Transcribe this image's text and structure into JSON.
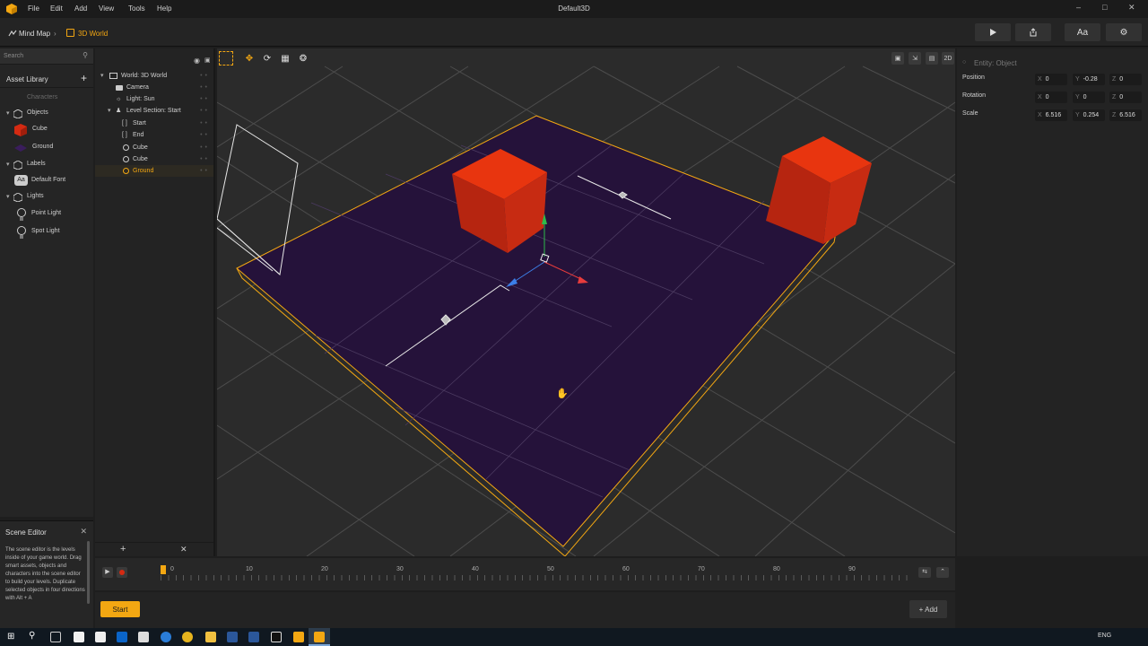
{
  "window": {
    "title": "Default3D"
  },
  "menu": [
    "File",
    "Edit",
    "Add",
    "View",
    "Tools",
    "Help"
  ],
  "breadcrumb": {
    "parent": "Mind Map",
    "current": "3D World"
  },
  "toolbar": {
    "play_icon": "play-icon",
    "share_icon": "share-icon",
    "font_label": "Aa",
    "settings_icon": "gear-icon"
  },
  "asset_library": {
    "search_placeholder": "Search",
    "title": "Asset Library",
    "items": [
      {
        "label": "Characters",
        "type": "category-dim"
      },
      {
        "label": "Objects",
        "type": "category"
      },
      {
        "label": "Cube",
        "type": "item"
      },
      {
        "label": "Ground",
        "type": "item"
      },
      {
        "label": "Labels",
        "type": "category"
      },
      {
        "label": "Default Font",
        "type": "item"
      },
      {
        "label": "Lights",
        "type": "category"
      },
      {
        "label": "Point Light",
        "type": "item"
      },
      {
        "label": "Spot Light",
        "type": "item"
      }
    ]
  },
  "outliner": {
    "rows": [
      {
        "label": "World: 3D World",
        "indent": 0
      },
      {
        "label": "Camera",
        "indent": 1
      },
      {
        "label": "Light: Sun",
        "indent": 1
      },
      {
        "label": "Level Section: Start",
        "indent": 1
      },
      {
        "label": "Start",
        "indent": 2
      },
      {
        "label": "End",
        "indent": 2
      },
      {
        "label": "Cube",
        "indent": 2
      },
      {
        "label": "Cube",
        "indent": 2
      },
      {
        "label": "Ground",
        "indent": 2,
        "selected": true
      }
    ]
  },
  "viewport": {
    "mode_2d": "2D"
  },
  "properties": {
    "entity": "Entity: Object",
    "position": {
      "label": "Position",
      "x": "0",
      "y": "-0.28",
      "z": "0"
    },
    "rotation": {
      "label": "Rotation",
      "x": "0",
      "y": "0",
      "z": "0"
    },
    "scale": {
      "label": "Scale",
      "x": "6.516",
      "y": "0.254",
      "z": "6.516"
    }
  },
  "scene_editor": {
    "title": "Scene Editor",
    "text": "The scene editor is the levels inside of your game world. Drag smart assets, objects and characters into the scene editor to build your levels. Duplicate selected objects in four directions with Alt + A"
  },
  "timeline": {
    "ticks": [
      "0",
      "10",
      "20",
      "30",
      "40",
      "50",
      "60",
      "70",
      "80",
      "90"
    ]
  },
  "bottom": {
    "start_label": "Start",
    "add_label": "+ Add"
  },
  "taskbar": {
    "lang": "ENG"
  },
  "colors": {
    "accent": "#f3a712",
    "cube": "#d42a12",
    "ground": "#25123a"
  }
}
